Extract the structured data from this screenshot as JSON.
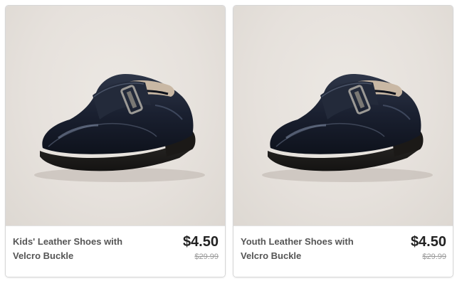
{
  "products": [
    {
      "title": "Kids' Leather Shoes with Velcro Buckle",
      "price": "$4.50",
      "original_price": "$29.99",
      "image": "black-leather-velcro-buckle-shoe"
    },
    {
      "title": "Youth Leather Shoes with Velcro Buckle",
      "price": "$4.50",
      "original_price": "$29.99",
      "image": "black-leather-velcro-buckle-shoe"
    }
  ],
  "colors": {
    "card_border": "#d7d7d7",
    "photo_background": "#e6e1dc",
    "title_text": "#555555",
    "price_text": "#222222",
    "original_price_text": "#999999"
  }
}
